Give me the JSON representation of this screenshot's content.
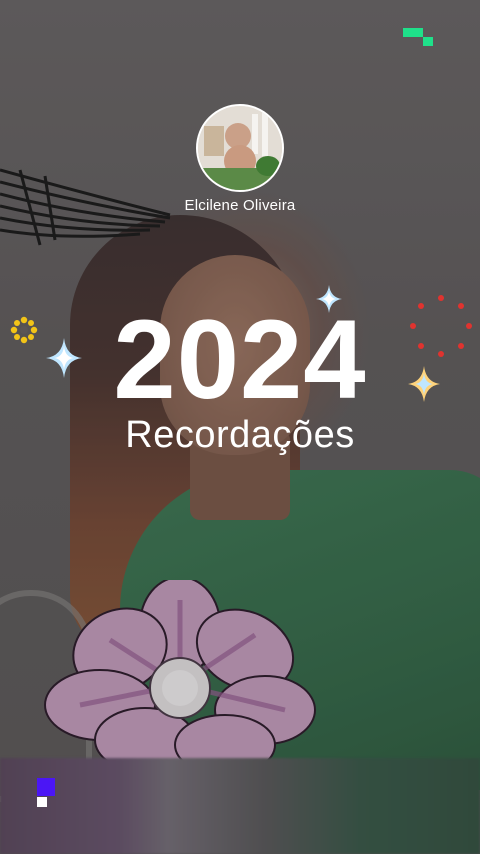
{
  "profile": {
    "name": "Elcilene Oliveira"
  },
  "story": {
    "year": "2024",
    "subtitle": "Recordações"
  },
  "icons": {
    "top_logo": "green-pixel-logo-icon",
    "bottom_logo": "purple-pixel-logo-icon",
    "sparkle": "sparkle-icon",
    "firework": "firework-icon",
    "sun": "sun-flower-icon"
  },
  "colors": {
    "accent_green": "#1fe08a",
    "accent_purple": "#4b16f5",
    "firework_red": "#e0332f",
    "sun_yellow": "#f2c418",
    "text": "#ffffff"
  }
}
